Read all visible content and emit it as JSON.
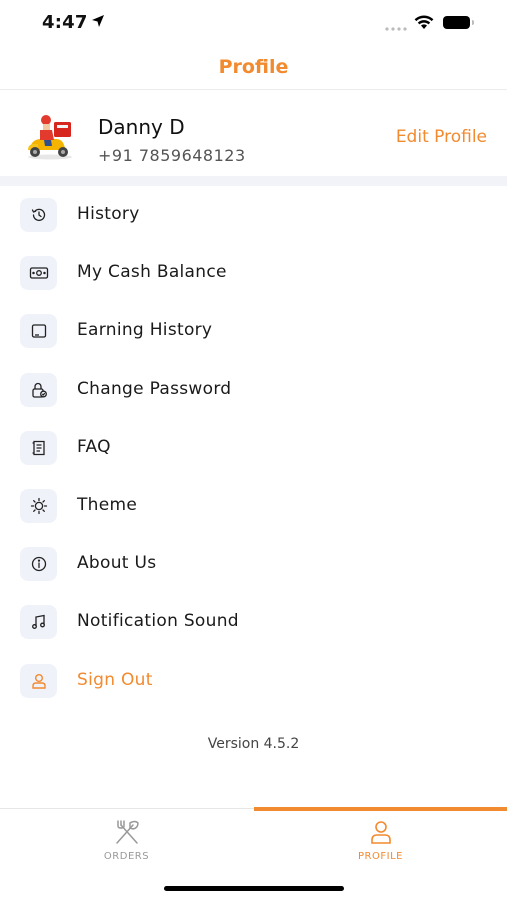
{
  "status_bar": {
    "time": "4:47"
  },
  "header": {
    "title": "Profile"
  },
  "profile": {
    "name": "Danny D",
    "phone": "+91 7859648123",
    "edit_label": "Edit Profile"
  },
  "menu": {
    "items": [
      {
        "label": "History",
        "icon": "history-icon"
      },
      {
        "label": "My Cash Balance",
        "icon": "cash-icon"
      },
      {
        "label": "Earning History",
        "icon": "tablet-icon"
      },
      {
        "label": "Change Password",
        "icon": "lock-icon"
      },
      {
        "label": "FAQ",
        "icon": "document-icon"
      },
      {
        "label": "Theme",
        "icon": "sun-icon"
      },
      {
        "label": "About Us",
        "icon": "info-icon"
      },
      {
        "label": "Notification Sound",
        "icon": "music-note-icon"
      },
      {
        "label": "Sign Out",
        "icon": "user-icon"
      }
    ]
  },
  "version": "Version 4.5.2",
  "tab_bar": {
    "tabs": [
      {
        "label": "ORDERS",
        "icon": "fork-knife-icon",
        "active": false
      },
      {
        "label": "PROFILE",
        "icon": "user-icon",
        "active": true
      }
    ]
  },
  "colors": {
    "accent": "#f28a2f",
    "icon_bg": "#eff2f9"
  }
}
